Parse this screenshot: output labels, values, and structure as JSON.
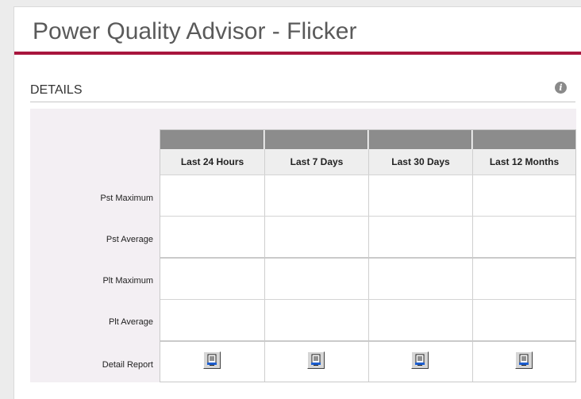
{
  "header": {
    "title": "Power Quality Advisor - Flicker"
  },
  "details": {
    "heading": "DETAILS",
    "columns": [
      "Last 24 Hours",
      "Last 7 Days",
      "Last 30 Days",
      "Last 12 Months"
    ],
    "rows": [
      {
        "label": "Pst Maximum",
        "values": [
          "",
          "",
          "",
          ""
        ]
      },
      {
        "label": "Pst Average",
        "values": [
          "",
          "",
          "",
          ""
        ]
      },
      {
        "label": "Plt Maximum",
        "values": [
          "",
          "",
          "",
          ""
        ]
      },
      {
        "label": "Plt Average",
        "values": [
          "",
          "",
          "",
          ""
        ]
      }
    ],
    "report_row_label": "Detail Report"
  },
  "icons": {
    "info": "info-icon",
    "report": "report-document-icon"
  },
  "colors": {
    "accent_rule": "#a8153d",
    "header_bar": "#8c8c8c",
    "details_background": "#f3eff3"
  }
}
